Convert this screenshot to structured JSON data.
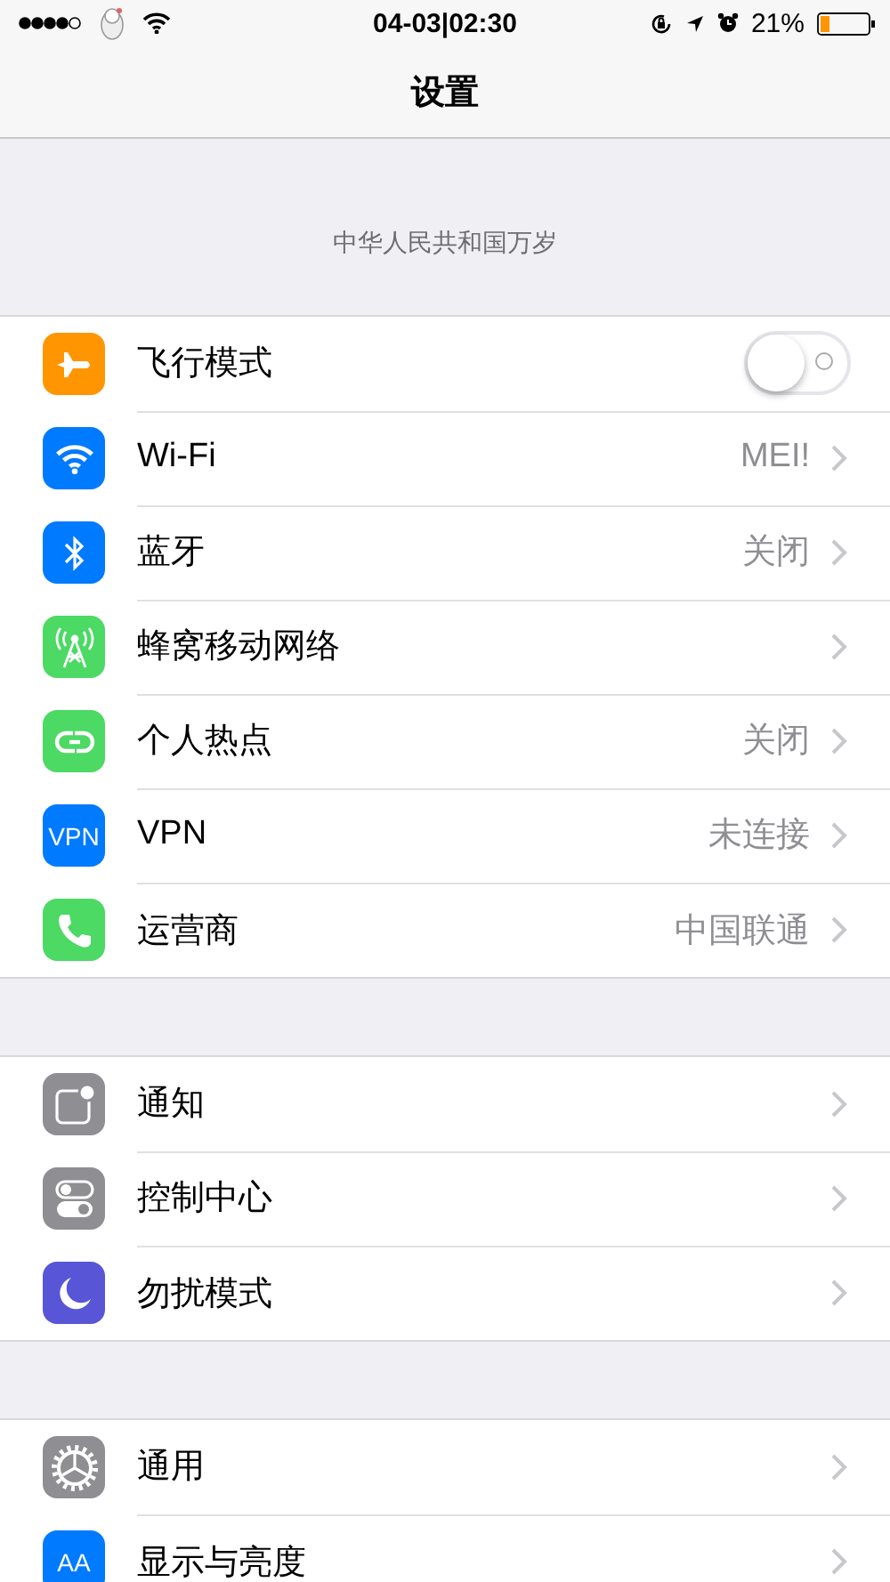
{
  "status_bar": {
    "time": "04-03|02:30",
    "battery_percent": "21%"
  },
  "nav_bar": {
    "title": "设置"
  },
  "header_text": "中华人民共和国万岁",
  "groups": [
    {
      "rows": [
        {
          "kind": "toggle",
          "color": "#ff9500",
          "label": "飞行模式",
          "on": false
        },
        {
          "kind": "link",
          "color": "#007aff",
          "label": "Wi-Fi",
          "value": "MEI!"
        },
        {
          "kind": "link",
          "color": "#007aff",
          "label": "蓝牙",
          "value": "关闭"
        },
        {
          "kind": "link",
          "color": "#4cd964",
          "label": "蜂窝移动网络"
        },
        {
          "kind": "link",
          "color": "#4cd964",
          "label": "个人热点",
          "value": "关闭"
        },
        {
          "kind": "link",
          "icon_label": "VPN",
          "color": "#007aff",
          "label": "VPN",
          "value": "未连接"
        },
        {
          "kind": "link",
          "color": "#4cd964",
          "label": "运营商",
          "value": "中国联通"
        }
      ]
    },
    {
      "rows": [
        {
          "kind": "link",
          "color": "#8e8e93",
          "label": "通知"
        },
        {
          "kind": "link",
          "color": "#8e8e93",
          "label": "控制中心"
        },
        {
          "kind": "link",
          "color": "#5856d6",
          "label": "勿扰模式"
        }
      ]
    },
    {
      "rows": [
        {
          "kind": "link",
          "color": "#8e8e93",
          "label": "通用"
        },
        {
          "kind": "link",
          "icon_label": "AA",
          "color": "#007aff",
          "label": "显示与亮度"
        }
      ]
    }
  ]
}
